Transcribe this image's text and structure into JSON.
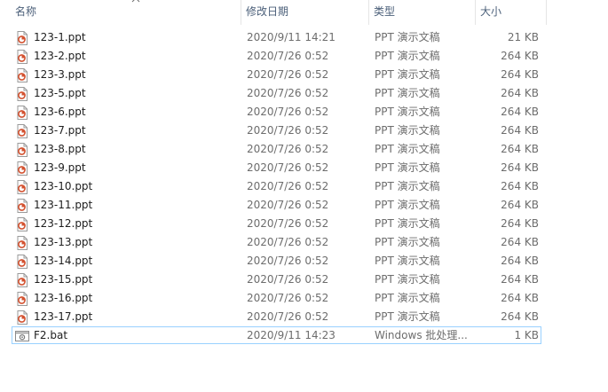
{
  "columns": {
    "name": "名称",
    "modified": "修改日期",
    "type": "类型",
    "size": "大小"
  },
  "files": [
    {
      "name": "123-1.ppt",
      "modified": "2020/9/11 14:21",
      "type": "PPT 演示文稿",
      "size": "21 KB",
      "icon": "ppt-file-icon"
    },
    {
      "name": "123-2.ppt",
      "modified": "2020/7/26 0:52",
      "type": "PPT 演示文稿",
      "size": "264 KB",
      "icon": "ppt-file-icon"
    },
    {
      "name": "123-3.ppt",
      "modified": "2020/7/26 0:52",
      "type": "PPT 演示文稿",
      "size": "264 KB",
      "icon": "ppt-file-icon"
    },
    {
      "name": "123-5.ppt",
      "modified": "2020/7/26 0:52",
      "type": "PPT 演示文稿",
      "size": "264 KB",
      "icon": "ppt-file-icon"
    },
    {
      "name": "123-6.ppt",
      "modified": "2020/7/26 0:52",
      "type": "PPT 演示文稿",
      "size": "264 KB",
      "icon": "ppt-file-icon"
    },
    {
      "name": "123-7.ppt",
      "modified": "2020/7/26 0:52",
      "type": "PPT 演示文稿",
      "size": "264 KB",
      "icon": "ppt-file-icon"
    },
    {
      "name": "123-8.ppt",
      "modified": "2020/7/26 0:52",
      "type": "PPT 演示文稿",
      "size": "264 KB",
      "icon": "ppt-file-icon"
    },
    {
      "name": "123-9.ppt",
      "modified": "2020/7/26 0:52",
      "type": "PPT 演示文稿",
      "size": "264 KB",
      "icon": "ppt-file-icon"
    },
    {
      "name": "123-10.ppt",
      "modified": "2020/7/26 0:52",
      "type": "PPT 演示文稿",
      "size": "264 KB",
      "icon": "ppt-file-icon"
    },
    {
      "name": "123-11.ppt",
      "modified": "2020/7/26 0:52",
      "type": "PPT 演示文稿",
      "size": "264 KB",
      "icon": "ppt-file-icon"
    },
    {
      "name": "123-12.ppt",
      "modified": "2020/7/26 0:52",
      "type": "PPT 演示文稿",
      "size": "264 KB",
      "icon": "ppt-file-icon"
    },
    {
      "name": "123-13.ppt",
      "modified": "2020/7/26 0:52",
      "type": "PPT 演示文稿",
      "size": "264 KB",
      "icon": "ppt-file-icon"
    },
    {
      "name": "123-14.ppt",
      "modified": "2020/7/26 0:52",
      "type": "PPT 演示文稿",
      "size": "264 KB",
      "icon": "ppt-file-icon"
    },
    {
      "name": "123-15.ppt",
      "modified": "2020/7/26 0:52",
      "type": "PPT 演示文稿",
      "size": "264 KB",
      "icon": "ppt-file-icon"
    },
    {
      "name": "123-16.ppt",
      "modified": "2020/7/26 0:52",
      "type": "PPT 演示文稿",
      "size": "264 KB",
      "icon": "ppt-file-icon"
    },
    {
      "name": "123-17.ppt",
      "modified": "2020/7/26 0:52",
      "type": "PPT 演示文稿",
      "size": "264 KB",
      "icon": "ppt-file-icon"
    },
    {
      "name": "F2.bat",
      "modified": "2020/9/11 14:23",
      "type": "Windows 批处理...",
      "size": "1 KB",
      "icon": "bat-file-icon",
      "selected": true
    }
  ],
  "colors": {
    "ppt_icon": "#d35230",
    "selection_border": "#99d1ff",
    "header_text": "#4c607a"
  }
}
